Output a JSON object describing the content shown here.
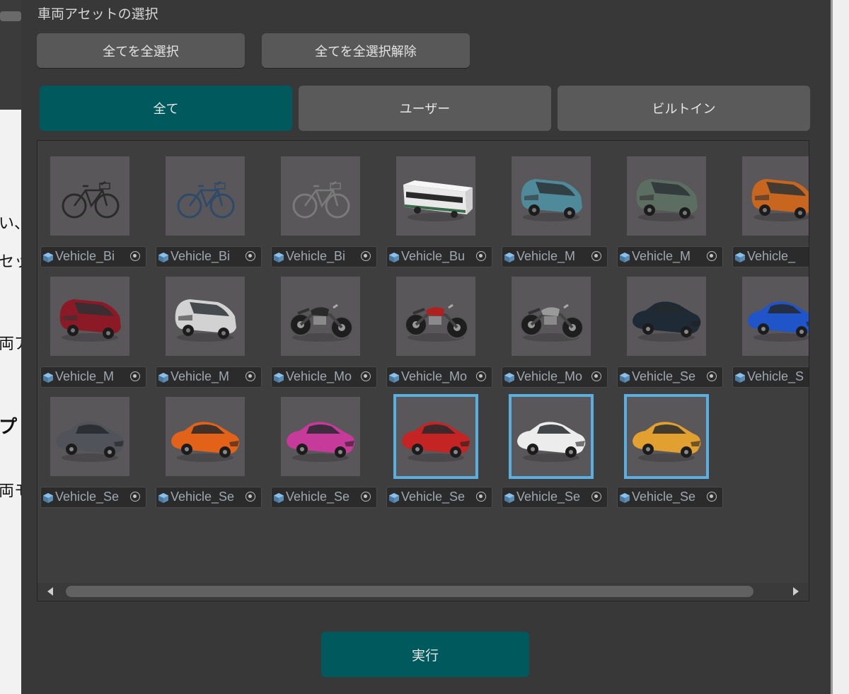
{
  "background_doc": {
    "fragments": [
      "い、",
      "セッ",
      "両ア",
      "プ",
      "両モ"
    ]
  },
  "panel": {
    "title": "車両アセットの選択",
    "select_all": "全てを全選択",
    "deselect_all": "全てを全選択解除",
    "tabs": [
      {
        "label": "全て",
        "active": true
      },
      {
        "label": "ユーザー",
        "active": false
      },
      {
        "label": "ビルトイン",
        "active": false
      }
    ],
    "run_button": "実行",
    "selection_color": "#5aaee0",
    "accent_color": "#00595c"
  },
  "assets": [
    {
      "label": "Vehicle_Bi",
      "kind": "bicycle",
      "color": "#2a2a2a",
      "selected": false
    },
    {
      "label": "Vehicle_Bi",
      "kind": "bicycle",
      "color": "#2e4a6a",
      "selected": false
    },
    {
      "label": "Vehicle_Bi",
      "kind": "bicycle",
      "color": "#7a7a7a",
      "selected": false
    },
    {
      "label": "Vehicle_Bu",
      "kind": "bus",
      "color": "#e8e8e8",
      "selected": false
    },
    {
      "label": "Vehicle_M",
      "kind": "van",
      "color": "#4f8a9a",
      "selected": false
    },
    {
      "label": "Vehicle_M",
      "kind": "van",
      "color": "#5c6e62",
      "selected": false
    },
    {
      "label": "Vehicle_",
      "kind": "van",
      "color": "#c8651e",
      "selected": false
    },
    {
      "label": "Vehicle_M",
      "kind": "van",
      "color": "#8c1a26",
      "selected": false
    },
    {
      "label": "Vehicle_M",
      "kind": "van",
      "color": "#d2d2d2",
      "selected": false
    },
    {
      "label": "Vehicle_Mo",
      "kind": "motorcycle",
      "color": "#2a2a2a",
      "selected": false
    },
    {
      "label": "Vehicle_Mo",
      "kind": "motorcycle",
      "color": "#b02020",
      "selected": false
    },
    {
      "label": "Vehicle_Mo",
      "kind": "motorcycle",
      "color": "#9a9a9a",
      "selected": false
    },
    {
      "label": "Vehicle_Se",
      "kind": "sedan",
      "color": "#1e2a36",
      "selected": false
    },
    {
      "label": "Vehicle_S",
      "kind": "sedan",
      "color": "#1f55c8",
      "selected": false
    },
    {
      "label": "Vehicle_Se",
      "kind": "sedan",
      "color": "#50545a",
      "selected": false
    },
    {
      "label": "Vehicle_Se",
      "kind": "sedan",
      "color": "#e2621a",
      "selected": false
    },
    {
      "label": "Vehicle_Se",
      "kind": "sedan",
      "color": "#c63a9a",
      "selected": false
    },
    {
      "label": "Vehicle_Se",
      "kind": "sedan",
      "color": "#c42424",
      "selected": true
    },
    {
      "label": "Vehicle_Se",
      "kind": "sedan",
      "color": "#ececec",
      "selected": true
    },
    {
      "label": "Vehicle_Se",
      "kind": "sedan",
      "color": "#e2a030",
      "selected": true
    }
  ]
}
